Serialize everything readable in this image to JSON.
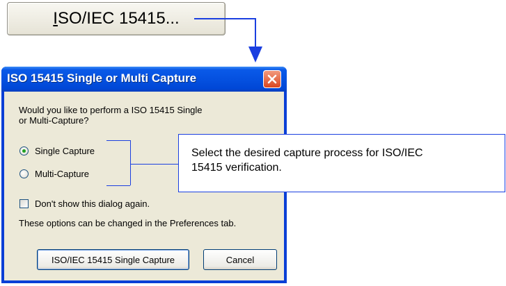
{
  "top_button": {
    "label_underlined": "I",
    "label_rest": "SO/IEC 15415..."
  },
  "dialog": {
    "title": "ISO 15415 Single or Multi Capture",
    "question_line1": "Would you like to perform a ISO 15415 Single",
    "question_line2": "or Multi-Capture?",
    "options": [
      {
        "label": "Single Capture",
        "selected": true
      },
      {
        "label": "Multi-Capture",
        "selected": false
      }
    ],
    "dont_show_label": "Don't show this dialog again.",
    "dont_show_checked": false,
    "preferences_note": "These options can be changed in the Preferences tab.",
    "primary_button": "ISO/IEC 15415 Single Capture",
    "cancel_button": "Cancel"
  },
  "callout": {
    "line1": "Select the desired capture process for ISO/IEC",
    "line2": "15415 verification."
  },
  "colors": {
    "connector": "#1a3fe0",
    "titlebar": "#0551e0",
    "client": "#ece9d8",
    "close": "#d9461f"
  },
  "icons": [
    "close-icon",
    "arrow-down-icon"
  ]
}
